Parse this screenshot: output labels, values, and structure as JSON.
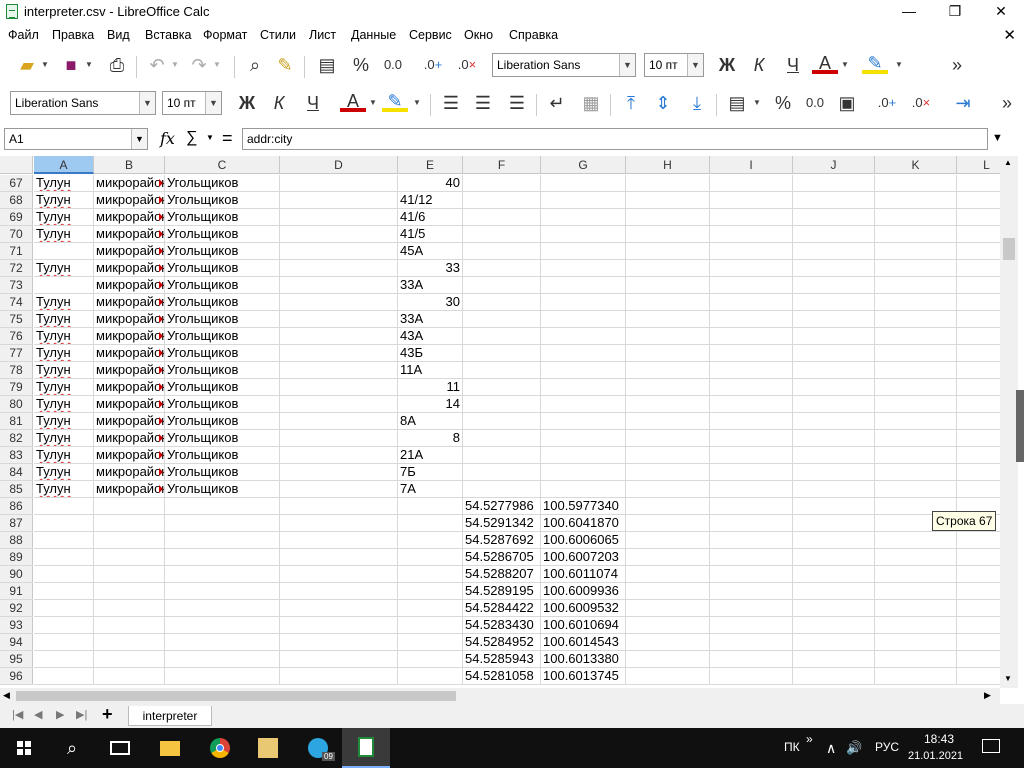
{
  "window": {
    "title": "interpreter.csv - LibreOffice Calc",
    "minimize": "—",
    "maximize": "❐",
    "close": "✕"
  },
  "menu": {
    "items": [
      "Файл",
      "Правка",
      "Вид",
      "Вставка",
      "Формат",
      "Стили",
      "Лист",
      "Данные",
      "Сервис",
      "Окно",
      "Справка"
    ],
    "close_doc": "✕"
  },
  "toolbar1": {
    "font_name": "Liberation Sans",
    "font_size": "10 пт",
    "bold": "Ж",
    "italic": "К",
    "underline": "Ч",
    "font_color": "A",
    "percent": "%",
    "decimal": "0.0",
    "more": "»"
  },
  "toolbar2": {
    "font_name": "Liberation Sans",
    "font_size": "10 пт",
    "bold": "Ж",
    "italic": "К",
    "underline": "Ч",
    "font_color": "A",
    "percent": "%",
    "decimal": "0.0",
    "more": "»"
  },
  "formula_bar": {
    "name_box": "A1",
    "fx": "fx",
    "sum": "∑",
    "equals": "=",
    "content": "addr:city"
  },
  "grid": {
    "columns": [
      "A",
      "B",
      "C",
      "D",
      "E",
      "F",
      "G",
      "H",
      "I",
      "J",
      "K",
      "L"
    ],
    "selected_column": "A",
    "rows": [
      {
        "n": "67",
        "A": "Тулун",
        "B": "микрорайон",
        "C": "Угольщиков",
        "E": "40",
        "E_num": true
      },
      {
        "n": "68",
        "A": "Тулун",
        "B": "микрорайон",
        "C": "Угольщиков",
        "E": "41/12"
      },
      {
        "n": "69",
        "A": "Тулун",
        "B": "микрорайон",
        "C": "Угольщиков",
        "E": "41/6"
      },
      {
        "n": "70",
        "A": "Тулун",
        "B": "микрорайон",
        "C": "Угольщиков",
        "E": "41/5"
      },
      {
        "n": "71",
        "A": "",
        "B": "микрорайон",
        "C": "Угольщиков",
        "E": "45А"
      },
      {
        "n": "72",
        "A": "Тулун",
        "B": "микрорайон",
        "C": "Угольщиков",
        "E": "33",
        "E_num": true
      },
      {
        "n": "73",
        "A": "",
        "B": "микрорайон",
        "C": "Угольщиков",
        "E": "33А"
      },
      {
        "n": "74",
        "A": "Тулун",
        "B": "микрорайон",
        "C": "Угольщиков",
        "E": "30",
        "E_num": true
      },
      {
        "n": "75",
        "A": "Тулун",
        "B": "микрорайон",
        "C": "Угольщиков",
        "E": "33А"
      },
      {
        "n": "76",
        "A": "Тулун",
        "B": "микрорайон",
        "C": "Угольщиков",
        "E": "43А"
      },
      {
        "n": "77",
        "A": "Тулун",
        "B": "микрорайон",
        "C": "Угольщиков",
        "E": "43Б"
      },
      {
        "n": "78",
        "A": "Тулун",
        "B": "микрорайон",
        "C": "Угольщиков",
        "E": "11А"
      },
      {
        "n": "79",
        "A": "Тулун",
        "B": "микрорайон",
        "C": "Угольщиков",
        "E": "11",
        "E_num": true
      },
      {
        "n": "80",
        "A": "Тулун",
        "B": "микрорайон",
        "C": "Угольщиков",
        "E": "14",
        "E_num": true
      },
      {
        "n": "81",
        "A": "Тулун",
        "B": "микрорайон",
        "C": "Угольщиков",
        "E": "8А"
      },
      {
        "n": "82",
        "A": "Тулун",
        "B": "микрорайон",
        "C": "Угольщиков",
        "E": "8",
        "E_num": true
      },
      {
        "n": "83",
        "A": "Тулун",
        "B": "микрорайон",
        "C": "Угольщиков",
        "E": "21А"
      },
      {
        "n": "84",
        "A": "Тулун",
        "B": "микрорайон",
        "C": "Угольщиков",
        "E": "7Б"
      },
      {
        "n": "85",
        "A": "Тулун",
        "B": "микрорайон",
        "C": "Угольщиков",
        "E": "7А"
      },
      {
        "n": "86",
        "F": "54.5277986",
        "G": "100.5977340"
      },
      {
        "n": "87",
        "F": "54.5291342",
        "G": "100.6041870"
      },
      {
        "n": "88",
        "F": "54.5287692",
        "G": "100.6006065"
      },
      {
        "n": "89",
        "F": "54.5286705",
        "G": "100.6007203"
      },
      {
        "n": "90",
        "F": "54.5288207",
        "G": "100.6011074"
      },
      {
        "n": "91",
        "F": "54.5289195",
        "G": "100.6009936"
      },
      {
        "n": "92",
        "F": "54.5284422",
        "G": "100.6009532"
      },
      {
        "n": "93",
        "F": "54.5283430",
        "G": "100.6010694"
      },
      {
        "n": "94",
        "F": "54.5284952",
        "G": "100.6014543"
      },
      {
        "n": "95",
        "F": "54.5285943",
        "G": "100.6013380"
      },
      {
        "n": "96",
        "F": "54.5281058",
        "G": "100.6013745"
      }
    ]
  },
  "tooltip": "Строка 67",
  "sheet_tabs": {
    "add": "+",
    "active": "interpreter"
  },
  "taskbar": {
    "lang_short": "ПК",
    "lang": "РУС",
    "time": "18:43",
    "date": "21.01.2021",
    "badge": "09"
  }
}
